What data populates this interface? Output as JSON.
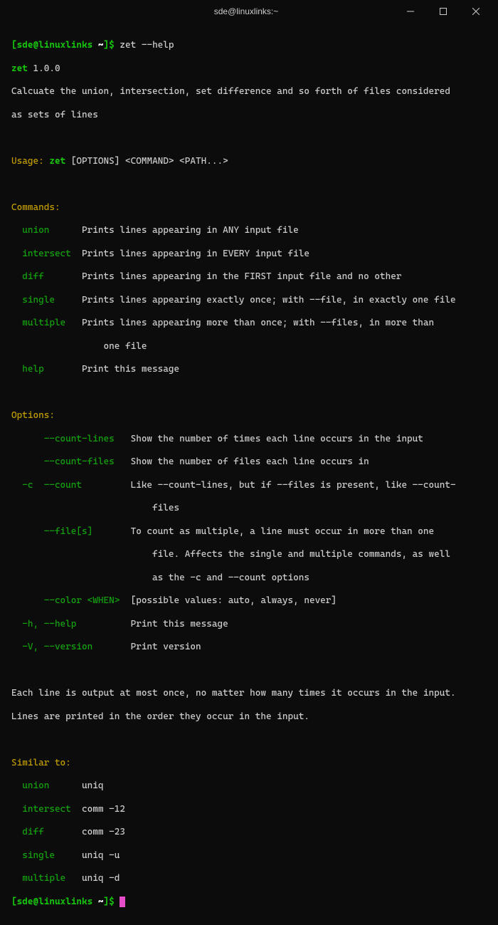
{
  "window": {
    "title": "sde@linuxlinks:~"
  },
  "prompt": {
    "open": "[",
    "user_host": "sde@linuxlinks",
    "path": " ~",
    "close": "]$ "
  },
  "command": "zet --help",
  "version_line": {
    "name": "zet",
    "ver": " 1.0.0"
  },
  "desc1": "Calcuate the union, intersection, set difference and so forth of files considered",
  "desc2": "as sets of lines",
  "usage": {
    "label": "Usage: ",
    "cmd": "zet",
    "args": " [OPTIONS] <COMMAND> <PATH...>"
  },
  "commands_header": "Commands:",
  "commands": [
    {
      "name": "union    ",
      "desc": "  Prints lines appearing in ANY input file"
    },
    {
      "name": "intersect",
      "desc": "  Prints lines appearing in EVERY input file"
    },
    {
      "name": "diff     ",
      "desc": "  Prints lines appearing in the FIRST input file and no other"
    },
    {
      "name": "single   ",
      "desc": "  Prints lines appearing exactly once; with --file, in exactly one file"
    },
    {
      "name": "multiple ",
      "desc": "  Prints lines appearing more than once; with --files, in more than"
    },
    {
      "name": "help     ",
      "desc": "  Print this message"
    }
  ],
  "multiple_cont": "                 one file",
  "options_header": "Options:",
  "options": [
    {
      "flags": "      --count-lines   ",
      "desc": "Show the number of times each line occurs in the input"
    },
    {
      "flags": "      --count-files   ",
      "desc": "Show the number of files each line occurs in"
    },
    {
      "flags": "  -c  --count         ",
      "desc": "Like --count-lines, but if --files is present, like --count-"
    },
    {
      "flags": "      --file[s]       ",
      "desc": "To count as multiple, a line must occur in more than one"
    },
    {
      "flags": "      --color <WHEN>  ",
      "desc": "[possible values: auto, always, never]"
    },
    {
      "flags": "  -h, --help          ",
      "desc": "Print this message"
    },
    {
      "flags": "  -V, --version       ",
      "desc": "Print version"
    }
  ],
  "count_cont": "                          files",
  "files_cont1": "                          file. Affects the single and multiple commands, as well",
  "files_cont2": "                          as the -c and --count options",
  "footer1": "Each line is output at most once, no matter how many times it occurs in the input.",
  "footer2": "Lines are printed in the order they occur in the input.",
  "similar_header": "Similar to:",
  "similar": [
    {
      "name": "union    ",
      "eq": "  uniq"
    },
    {
      "name": "intersect",
      "eq": "  comm -12"
    },
    {
      "name": "diff     ",
      "eq": "  comm -23"
    },
    {
      "name": "single   ",
      "eq": "  uniq -u"
    },
    {
      "name": "multiple ",
      "eq": "  uniq -d"
    }
  ]
}
